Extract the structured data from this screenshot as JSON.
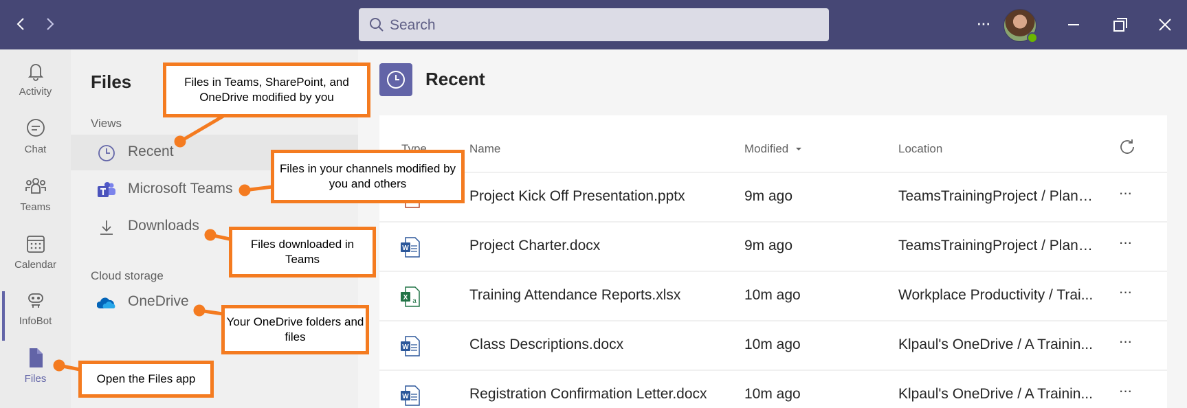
{
  "titlebar": {
    "search_placeholder": "Search",
    "more_label": "···"
  },
  "appbar": {
    "items": [
      {
        "label": "Activity",
        "icon": "bell-icon"
      },
      {
        "label": "Chat",
        "icon": "chat-icon"
      },
      {
        "label": "Teams",
        "icon": "teams-icon"
      },
      {
        "label": "Calendar",
        "icon": "calendar-icon"
      },
      {
        "label": "InfoBot",
        "icon": "bot-icon"
      },
      {
        "label": "Files",
        "icon": "file-icon",
        "active": true
      }
    ]
  },
  "filespane": {
    "title": "Files",
    "views_heading": "Views",
    "views": [
      {
        "label": "Recent",
        "icon": "clock-icon",
        "selected": true
      },
      {
        "label": "Microsoft Teams",
        "icon": "ms-teams-icon"
      },
      {
        "label": "Downloads",
        "icon": "download-icon"
      }
    ],
    "cloud_heading": "Cloud storage",
    "cloud": [
      {
        "label": "OneDrive",
        "icon": "onedrive-icon"
      }
    ]
  },
  "main": {
    "title": "Recent",
    "columns": {
      "type": "Type",
      "name": "Name",
      "modified": "Modified",
      "location": "Location"
    },
    "rows": [
      {
        "type": "powerpoint",
        "name": "Project Kick Off Presentation.pptx",
        "modified": "9m ago",
        "location": "TeamsTrainingProject / Planni..."
      },
      {
        "type": "word",
        "name": "Project Charter.docx",
        "modified": "9m ago",
        "location": "TeamsTrainingProject / Planni..."
      },
      {
        "type": "excel",
        "name": "Training Attendance Reports.xlsx",
        "modified": "10m ago",
        "location": "Workplace Productivity / Trai..."
      },
      {
        "type": "word",
        "name": "Class Descriptions.docx",
        "modified": "10m ago",
        "location": "Klpaul's OneDrive / A Trainin..."
      },
      {
        "type": "word",
        "name": "Registration Confirmation Letter.docx",
        "modified": "10m ago",
        "location": "Klpaul's OneDrive / A Trainin..."
      }
    ],
    "row_more_label": "···"
  },
  "callouts": {
    "recent": "Files in Teams, SharePoint, and OneDrive modified by you",
    "teams": "Files in your channels modified by you and others",
    "downloads": "Files downloaded in Teams",
    "onedrive": "Your OneDrive folders and files",
    "files_app": "Open the Files app"
  },
  "colors": {
    "titlebar": "#464775",
    "brand": "#6264a7",
    "callout_border": "#f47b20",
    "word": "#2b579a",
    "excel": "#217346"
  }
}
